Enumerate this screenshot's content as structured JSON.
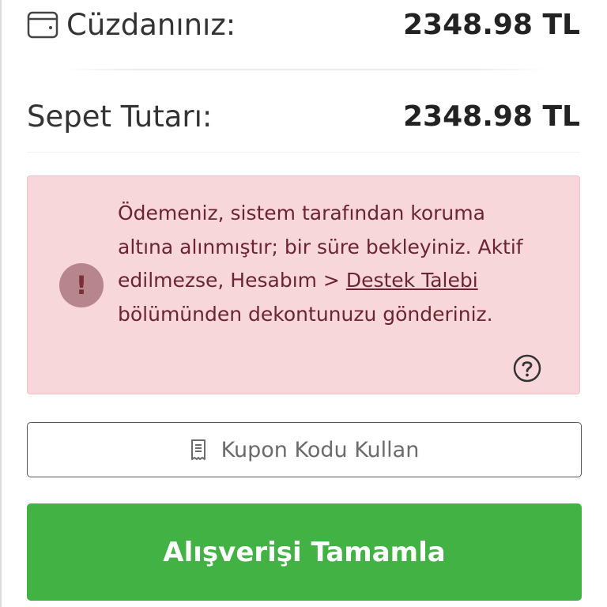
{
  "wallet": {
    "icon": "wallet-icon",
    "label": "Cüzdanınız:",
    "value": "2348.98 TL"
  },
  "cart": {
    "label": "Sepet Tutarı:",
    "value": "2348.98 TL"
  },
  "alert": {
    "icon": "exclamation-icon",
    "icon_glyph": "!",
    "text_part1": "Ödemeniz, sistem tarafından koruma altına alınmıştır; bir süre bekleyiniz. Aktif edilmezse, Hesabım > ",
    "link_text": "Destek Talebi",
    "text_part2": " bölümünden dekontunuzu gönderiniz.",
    "help_icon": "question-circle-icon",
    "background_color": "#f8d7da",
    "text_color": "#6b2530"
  },
  "coupon_button": {
    "icon": "receipt-icon",
    "label": "Kupon Kodu Kullan"
  },
  "checkout_button": {
    "label": "Alışverişi Tamamla",
    "color": "#43b244"
  }
}
